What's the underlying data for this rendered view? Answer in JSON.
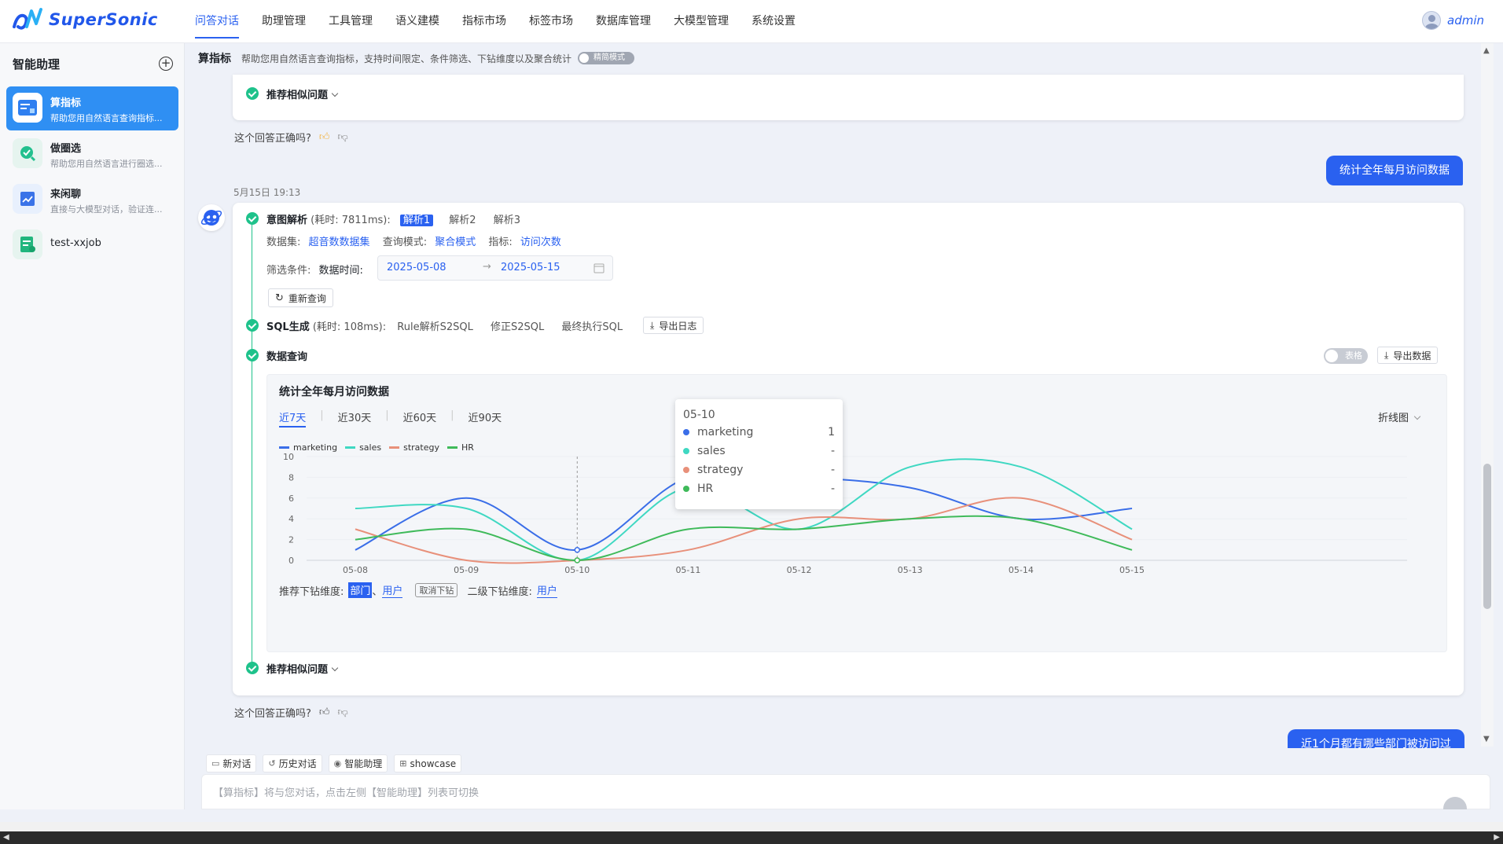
{
  "app": {
    "logo_text": "SuperSonic"
  },
  "nav": {
    "items": [
      "问答对话",
      "助理管理",
      "工具管理",
      "语义建模",
      "指标市场",
      "标签市场",
      "数据库管理",
      "大模型管理",
      "系统设置"
    ],
    "active": "问答对话",
    "user": "admin"
  },
  "sidebar": {
    "title": "智能助理",
    "agents": [
      {
        "name": "算指标",
        "desc": "帮助您用自然语言查询指标...",
        "active": true
      },
      {
        "name": "做圈选",
        "desc": "帮助您用自然语言进行圈选...",
        "active": false
      },
      {
        "name": "来闲聊",
        "desc": "直接与大模型对话，验证连...",
        "active": false
      },
      {
        "name": "test-xxjob",
        "desc": "",
        "active": false
      }
    ]
  },
  "context": {
    "title": "算指标",
    "desc": "帮助您用自然语言查询指标，支持时间限定、条件筛选、下钻维度以及聚合统计",
    "toggle_label": "精简模式"
  },
  "prev_message": {
    "similar_label": "推荐相似问题",
    "feedback_label": "这个回答正确吗?"
  },
  "user_message_1": "统计全年每月访问数据",
  "timestamp": "5月15日 19:13",
  "answer": {
    "intent_label": "意图解析",
    "intent_time": "(耗时: 7811ms):",
    "parse_tabs": [
      "解析1",
      "解析2",
      "解析3"
    ],
    "dataset_label": "数据集:",
    "dataset_value": "超音数数据集",
    "mode_label": "查询模式:",
    "mode_value": "聚合模式",
    "metric_label": "指标:",
    "metric_value": "访问次数",
    "filter_label": "筛选条件:",
    "date_field_label": "数据时间:",
    "date_start": "2025-05-08",
    "date_end": "2025-05-15",
    "requery_label": "重新查询",
    "sql_label": "SQL生成",
    "sql_time": "(耗时: 108ms):",
    "sql_tabs": [
      "Rule解析S2SQL",
      "修正S2SQL",
      "最终执行SQL"
    ],
    "export_log_label": "导出日志",
    "query_label": "数据查询",
    "table_toggle_label": "表格",
    "export_data_label": "导出数据",
    "chart_title": "统计全年每月访问数据",
    "range_tabs": [
      "近7天",
      "近30天",
      "近60天",
      "近90天"
    ],
    "chart_type_label": "折线图",
    "drill_label": "推荐下钻维度:",
    "drill_dims": [
      "部门",
      "用户"
    ],
    "drill_sep": "、",
    "cancel_drill_label": "取消下钻",
    "drill2_label": "二级下钻维度:",
    "drill2_dims": [
      "用户"
    ],
    "similar_label": "推荐相似问题",
    "feedback_label": "这个回答正确吗?"
  },
  "tooltip": {
    "title": "05-10",
    "rows": [
      {
        "name": "marketing",
        "value": "1",
        "color": "#3a6ee8"
      },
      {
        "name": "sales",
        "value": "-",
        "color": "#3fd8c2"
      },
      {
        "name": "strategy",
        "value": "-",
        "color": "#e8907a"
      },
      {
        "name": "HR",
        "value": "-",
        "color": "#3fba5a"
      }
    ]
  },
  "chart_data": {
    "type": "line",
    "x": [
      "05-08",
      "05-09",
      "05-10",
      "05-11",
      "05-12",
      "05-13",
      "05-14",
      "05-15"
    ],
    "ylim": [
      0,
      10
    ],
    "yticks": [
      0,
      2,
      4,
      6,
      8,
      10
    ],
    "series": [
      {
        "name": "marketing",
        "color": "#3a6ee8",
        "values": [
          1,
          6,
          1,
          8,
          8,
          7,
          4,
          5
        ]
      },
      {
        "name": "sales",
        "color": "#3fd8c2",
        "values": [
          5,
          5,
          0,
          7,
          3,
          9,
          9,
          3
        ]
      },
      {
        "name": "strategy",
        "color": "#e8907a",
        "values": [
          3,
          0,
          0,
          1,
          4,
          4,
          6,
          2
        ]
      },
      {
        "name": "HR",
        "color": "#3fba5a",
        "values": [
          2,
          3,
          0,
          3,
          3,
          4,
          4,
          1
        ]
      }
    ],
    "grid": true,
    "legend": "top-left"
  },
  "user_message_2": "近1个月都有哪些部门被访问过",
  "bottom": {
    "quick": [
      {
        "icon": "chat-icon",
        "label": "新对话"
      },
      {
        "icon": "history-icon",
        "label": "历史对话"
      },
      {
        "icon": "robot-icon",
        "label": "智能助理"
      },
      {
        "icon": "grid-icon",
        "label": "showcase"
      }
    ],
    "placeholder": "【算指标】将与您对话，点击左侧【智能助理】列表可切换"
  }
}
